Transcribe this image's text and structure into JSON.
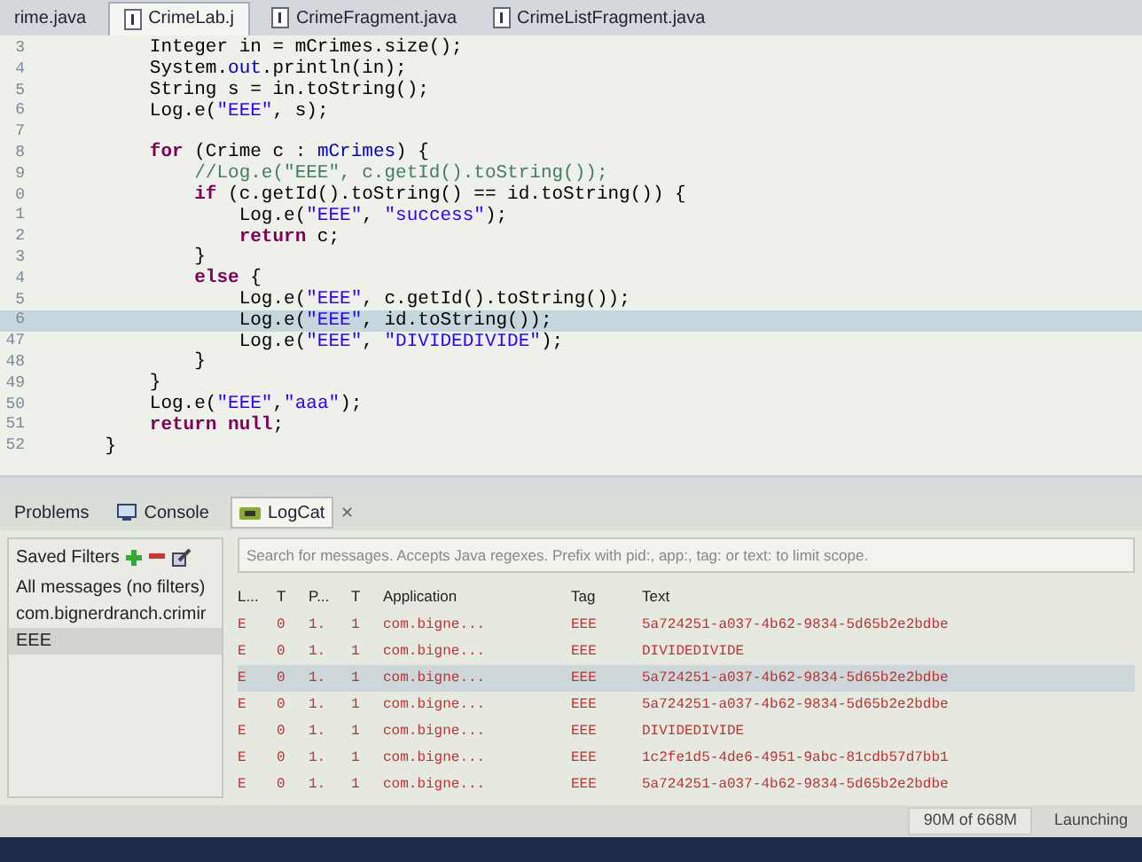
{
  "editor_tabs": [
    {
      "label": "rime.java",
      "selected": false
    },
    {
      "label": "CrimeLab.j",
      "selected": true
    },
    {
      "label": "CrimeFragment.java",
      "selected": false
    },
    {
      "label": "CrimeListFragment.java",
      "selected": false
    }
  ],
  "code_lines": [
    {
      "number": "3",
      "highlighted": false,
      "tokens": [
        {
          "kind": "plain",
          "text": "        Integer in = mCrimes.size();"
        }
      ]
    },
    {
      "number": "4",
      "highlighted": false,
      "tokens": [
        {
          "kind": "plain",
          "text": "        System."
        },
        {
          "kind": "field",
          "text": "out"
        },
        {
          "kind": "plain",
          "text": ".println(in);"
        }
      ]
    },
    {
      "number": "5",
      "highlighted": false,
      "tokens": [
        {
          "kind": "plain",
          "text": "        String s = in.toString();"
        }
      ]
    },
    {
      "number": "6",
      "highlighted": false,
      "tokens": [
        {
          "kind": "plain",
          "text": "        Log.e("
        },
        {
          "kind": "str",
          "text": "\"EEE\""
        },
        {
          "kind": "plain",
          "text": ", s);"
        }
      ]
    },
    {
      "number": "7",
      "highlighted": false
    },
    {
      "number": "8",
      "highlighted": false,
      "tokens": [
        {
          "kind": "kw",
          "text": "        for"
        },
        {
          "kind": "plain",
          "text": " (Crime c : "
        },
        {
          "kind": "field",
          "text": "mCrimes"
        },
        {
          "kind": "plain",
          "text": ") {"
        }
      ]
    },
    {
      "number": "9",
      "highlighted": false,
      "tokens": [
        {
          "kind": "comment",
          "text": "            //Log.e(\"EEE\", c.getId().toString());"
        }
      ]
    },
    {
      "number": "0",
      "highlighted": false,
      "tokens": [
        {
          "kind": "kw",
          "text": "            if"
        },
        {
          "kind": "plain",
          "text": " (c.getId().toString() == id.toString()) {"
        }
      ]
    },
    {
      "number": "1",
      "highlighted": false,
      "tokens": [
        {
          "kind": "plain",
          "text": "                Log.e("
        },
        {
          "kind": "str",
          "text": "\"EEE\""
        },
        {
          "kind": "plain",
          "text": ", "
        },
        {
          "kind": "str",
          "text": "\"success\""
        },
        {
          "kind": "plain",
          "text": ");"
        }
      ]
    },
    {
      "number": "2",
      "highlighted": false,
      "tokens": [
        {
          "kind": "kw",
          "text": "                return"
        },
        {
          "kind": "plain",
          "text": " c;"
        }
      ]
    },
    {
      "number": "3",
      "highlighted": false,
      "tokens": [
        {
          "kind": "plain",
          "text": "            }"
        }
      ]
    },
    {
      "number": "4",
      "highlighted": false,
      "tokens": [
        {
          "kind": "kw",
          "text": "            else"
        },
        {
          "kind": "plain",
          "text": " {"
        }
      ]
    },
    {
      "number": "5",
      "highlighted": false,
      "tokens": [
        {
          "kind": "plain",
          "text": "                Log.e("
        },
        {
          "kind": "str",
          "text": "\"EEE\""
        },
        {
          "kind": "plain",
          "text": ", c.getId().toString());"
        }
      ]
    },
    {
      "number": "6",
      "highlighted": true,
      "tokens": [
        {
          "kind": "plain",
          "text": "                Log.e("
        },
        {
          "kind": "str",
          "text": "\"EEE\""
        },
        {
          "kind": "plain",
          "text": ", id.toString());"
        }
      ]
    },
    {
      "number": "47",
      "highlighted": false,
      "tokens": [
        {
          "kind": "plain",
          "text": "                Log.e("
        },
        {
          "kind": "str",
          "text": "\"EEE\""
        },
        {
          "kind": "plain",
          "text": ", "
        },
        {
          "kind": "str",
          "text": "\"DIVIDEDIVIDE\""
        },
        {
          "kind": "plain",
          "text": ");"
        }
      ]
    },
    {
      "number": "48",
      "highlighted": false,
      "tokens": [
        {
          "kind": "plain",
          "text": "            }"
        }
      ]
    },
    {
      "number": "49",
      "highlighted": false,
      "tokens": [
        {
          "kind": "plain",
          "text": "        }"
        }
      ]
    },
    {
      "number": "50",
      "highlighted": false,
      "tokens": [
        {
          "kind": "plain",
          "text": "        Log.e("
        },
        {
          "kind": "str",
          "text": "\"EEE\""
        },
        {
          "kind": "plain",
          "text": ","
        },
        {
          "kind": "str",
          "text": "\"aaa\""
        },
        {
          "kind": "plain",
          "text": ");"
        }
      ]
    },
    {
      "number": "51",
      "highlighted": false,
      "tokens": [
        {
          "kind": "kw",
          "text": "        return null"
        },
        {
          "kind": "plain",
          "text": ";"
        }
      ]
    },
    {
      "number": "52",
      "highlighted": false,
      "tokens": [
        {
          "kind": "plain",
          "text": "    }"
        }
      ]
    }
  ],
  "panel_tabs": [
    {
      "label": "Problems",
      "selected": false
    },
    {
      "label": "Console",
      "selected": false
    },
    {
      "label": "LogCat",
      "selected": true
    }
  ],
  "panel_close": "✕",
  "saved_filters": {
    "title": "Saved Filters",
    "items": [
      {
        "label": "All messages (no filters)",
        "selected": false
      },
      {
        "label": "com.bignerdranch.crimir",
        "selected": false
      },
      {
        "label": "EEE",
        "selected": true
      }
    ]
  },
  "search": {
    "placeholder": "Search for messages. Accepts Java regexes. Prefix with pid:, app:, tag: or text: to limit scope."
  },
  "log_table": {
    "columns": [
      "L...",
      "T",
      "P...",
      "T",
      "Application",
      "Tag",
      "Text"
    ],
    "rows": [
      {
        "selected": false,
        "cells": [
          "E",
          "0",
          "1.",
          "1",
          "com.bigne...",
          "EEE",
          "5a724251-a037-4b62-9834-5d65b2e2bdbe"
        ]
      },
      {
        "selected": false,
        "cells": [
          "E",
          "0",
          "1.",
          "1",
          "com.bigne...",
          "EEE",
          "DIVIDEDIVIDE"
        ]
      },
      {
        "selected": true,
        "cells": [
          "E",
          "0",
          "1.",
          "1",
          "com.bigne...",
          "EEE",
          "5a724251-a037-4b62-9834-5d65b2e2bdbe"
        ]
      },
      {
        "selected": false,
        "cells": [
          "E",
          "0",
          "1.",
          "1",
          "com.bigne...",
          "EEE",
          "5a724251-a037-4b62-9834-5d65b2e2bdbe"
        ]
      },
      {
        "selected": false,
        "cells": [
          "E",
          "0",
          "1.",
          "1",
          "com.bigne...",
          "EEE",
          "DIVIDEDIVIDE"
        ]
      },
      {
        "selected": false,
        "cells": [
          "E",
          "0",
          "1.",
          "1",
          "com.bigne...",
          "EEE",
          "1c2fe1d5-4de6-4951-9abc-81cdb57d7bb1"
        ]
      },
      {
        "selected": false,
        "cells": [
          "E",
          "0",
          "1.",
          "1",
          "com.bigne...",
          "EEE",
          "5a724251-a037-4b62-9834-5d65b2e2bdbe"
        ]
      }
    ]
  },
  "status_bar": {
    "memory": "90M of 668M",
    "task": "Launching"
  }
}
